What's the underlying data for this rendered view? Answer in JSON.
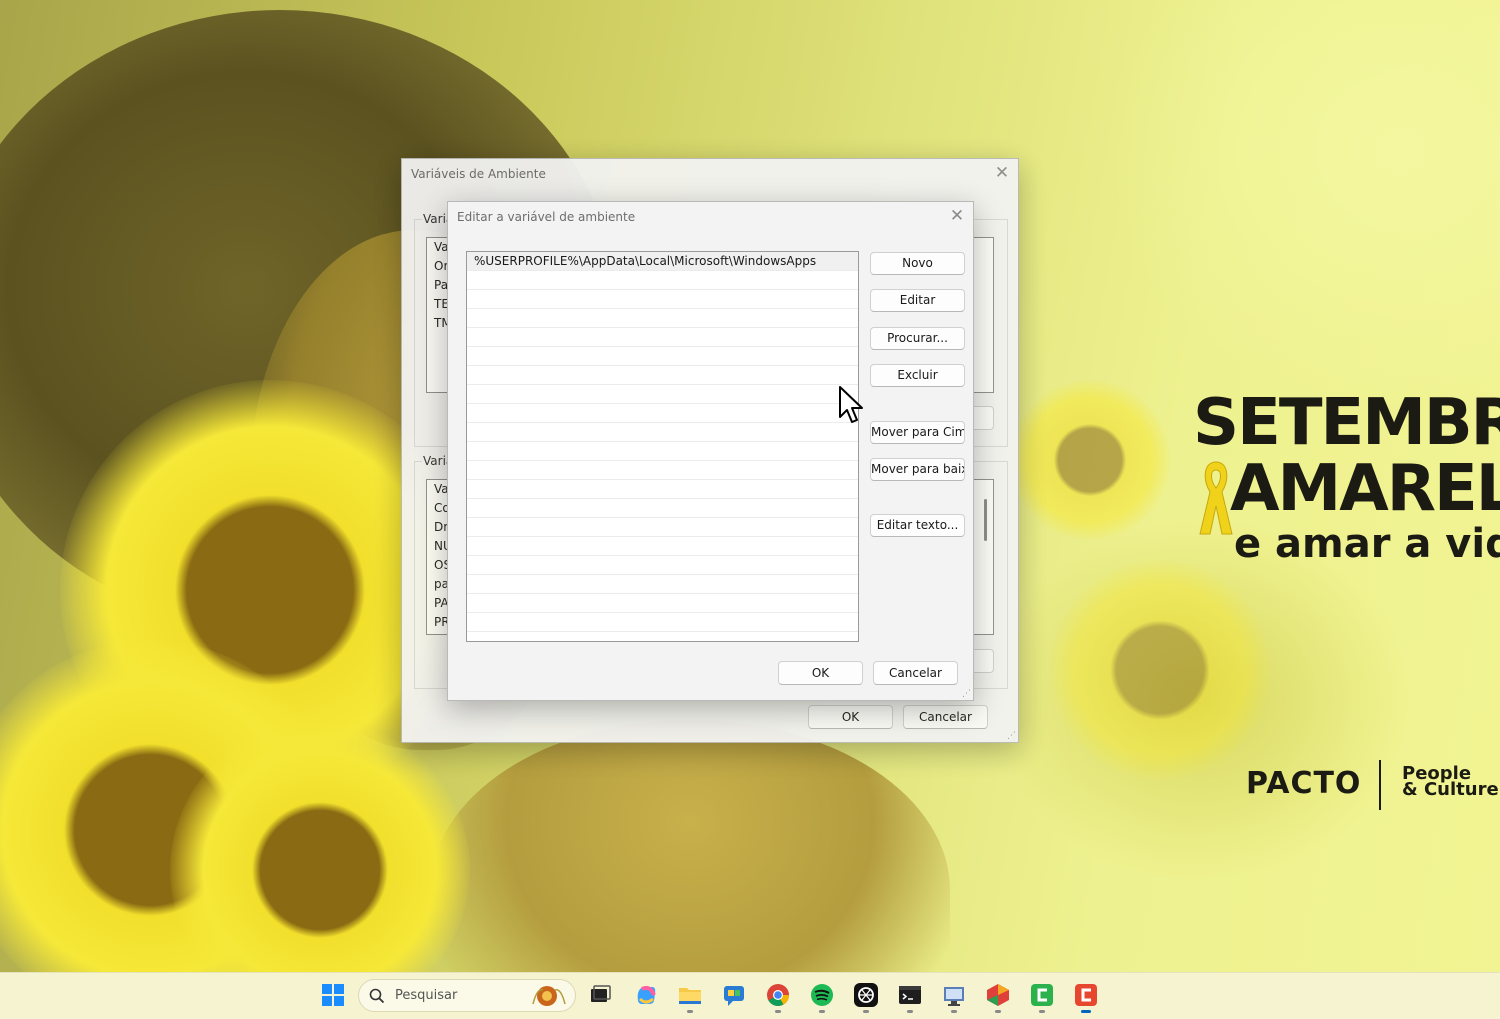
{
  "wallpaper": {
    "line1": "SETEMBRO",
    "line2": "AMARELO",
    "line3": "e amar a vida",
    "brand": "PACTO",
    "brand_sub_1": "People",
    "brand_sub_2": "& Culture"
  },
  "outer_dialog": {
    "title": "Variáveis de Ambiente",
    "user_group_label": "Variá",
    "user_list_header": "Va",
    "user_list_rows": [
      "Or",
      "Pa",
      "TE",
      "TM"
    ],
    "system_group_label": "Variá",
    "system_list_header": "Va",
    "system_list_rows": [
      "Co",
      "Dr",
      "NU",
      "OS",
      "pa",
      "PA",
      "PR"
    ],
    "ok_label": "OK",
    "cancel_label": "Cancelar"
  },
  "inner_dialog": {
    "title": "Editar a variável de ambiente",
    "paths": [
      "%USERPROFILE%\\AppData\\Local\\Microsoft\\WindowsApps"
    ],
    "buttons": {
      "new": "Novo",
      "edit": "Editar",
      "browse": "Procurar...",
      "delete": "Excluir",
      "move_up": "Mover para Cima",
      "move_down": "Mover para baixo",
      "edit_text": "Editar texto..."
    },
    "ok_label": "OK",
    "cancel_label": "Cancelar"
  },
  "taskbar": {
    "search_placeholder": "Pesquisar",
    "apps": [
      "windows-start",
      "task-view",
      "copilot",
      "file-explorer",
      "chat",
      "chrome",
      "spotify",
      "chatgpt",
      "terminal",
      "remote-desktop",
      "office",
      "green-app",
      "red-app"
    ]
  },
  "colors": {
    "accent": "#0067c0",
    "dialog_bg": "#f3f3f3",
    "spotify": "#1db954",
    "green_app": "#2bb24c",
    "red_app": "#e8472f"
  }
}
